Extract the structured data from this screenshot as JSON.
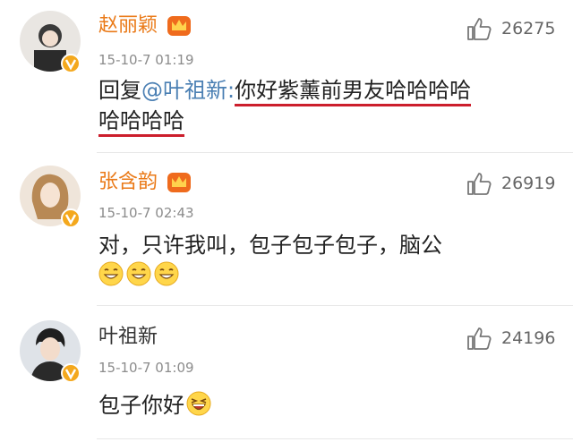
{
  "comments": [
    {
      "username": "赵丽颖",
      "timestamp": "15-10-7 01:19",
      "likes": "26275",
      "reply_prefix": "回复",
      "mention": "@叶祖新",
      "colon": ":",
      "text_line1": "你好紫薰前男友哈哈哈哈",
      "text_line2": "哈哈哈哈"
    },
    {
      "username": "张含韵",
      "timestamp": "15-10-7 02:43",
      "likes": "26919",
      "text": "对，只许我叫，包子包子包子，脑公",
      "emojis": [
        "grin-emoji",
        "grin-emoji",
        "grin-emoji"
      ]
    },
    {
      "username": "叶祖新",
      "timestamp": "15-10-7 01:09",
      "likes": "24196",
      "text": "包子你好",
      "emojis": [
        "laugh-emoji"
      ]
    }
  ],
  "colors": {
    "vip_name": "#ea7a18",
    "mention": "#4a7fb3",
    "underline": "#cc1e2c",
    "verified_badge": "#f4a81d"
  }
}
